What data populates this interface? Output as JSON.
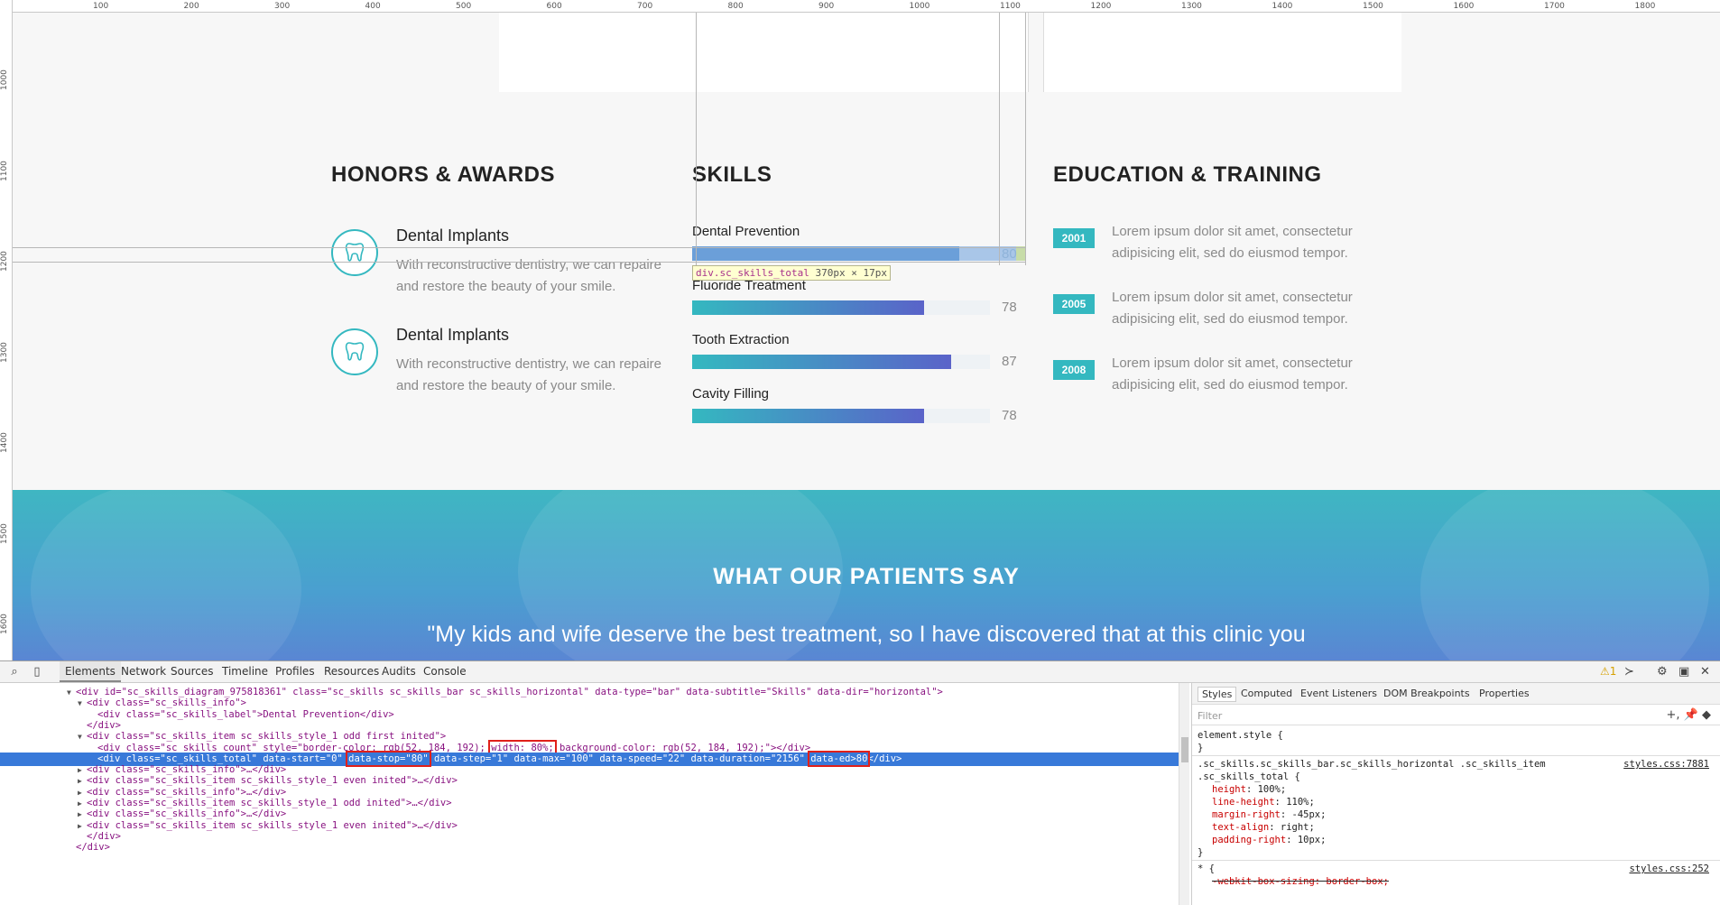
{
  "ruler": {
    "top": [
      "100",
      "200",
      "300",
      "400",
      "500",
      "600",
      "700",
      "800",
      "900",
      "1000",
      "1100",
      "1200",
      "1300",
      "1400",
      "1500",
      "1600",
      "1700",
      "1800"
    ],
    "left": [
      "1000",
      "1100",
      "1200",
      "1300",
      "1400",
      "1500",
      "1600"
    ]
  },
  "honors": {
    "title": "HONORS & AWARDS",
    "items": [
      {
        "title": "Dental Implants",
        "text": "With reconstructive dentistry, we can repaire and restore the beauty of your smile."
      },
      {
        "title": "Dental Implants",
        "text": "With reconstructive dentistry, we can repaire and restore the beauty of your smile."
      }
    ],
    "icon": "tooth-icon"
  },
  "skills": {
    "title": "SKILLS",
    "items": [
      {
        "label": "Dental Prevention",
        "value": "80",
        "percent": 80
      },
      {
        "label": "Fluoride Treatment",
        "value": "78",
        "percent": 78
      },
      {
        "label": "Tooth Extraction",
        "value": "87",
        "percent": 87
      },
      {
        "label": "Cavity Filling",
        "value": "78",
        "percent": 78
      }
    ],
    "tooltip": {
      "selector": "div.sc_skills_total",
      "size": "370px × 17px"
    }
  },
  "education": {
    "title": "EDUCATION & TRAINING",
    "items": [
      {
        "year": "2001",
        "text": "Lorem ipsum dolor sit amet, consectetur adipisicing elit, sed do eiusmod tempor."
      },
      {
        "year": "2005",
        "text": "Lorem ipsum dolor sit amet, consectetur adipisicing elit, sed do eiusmod tempor."
      },
      {
        "year": "2008",
        "text": "Lorem ipsum dolor sit amet, consectetur adipisicing elit, sed do eiusmod tempor."
      }
    ]
  },
  "testimonials": {
    "title": "WHAT OUR PATIENTS SAY",
    "quote": "\"My kids and wife deserve the best treatment, so I have discovered that at this clinic you"
  },
  "devtools": {
    "tabs": [
      "Elements",
      "Network",
      "Sources",
      "Timeline",
      "Profiles",
      "Resources",
      "Audits",
      "Console"
    ],
    "active_tab": "Elements",
    "warning_count": "1",
    "dom_lines": [
      {
        "indent": 0,
        "tri": "▼",
        "html": "<div id=\"sc_skills_diagram_975818361\" class=\"sc_skills sc_skills_bar sc_skills_horizontal\" data-type=\"bar\" data-subtitle=\"Skills\" data-dir=\"horizontal\">"
      },
      {
        "indent": 1,
        "tri": "▼",
        "html": "<div class=\"sc_skills_info\">"
      },
      {
        "indent": 2,
        "tri": "",
        "html": "<div class=\"sc_skills_label\">Dental Prevention</div>"
      },
      {
        "indent": 1,
        "tri": "",
        "html": "</div>"
      },
      {
        "indent": 1,
        "tri": "▼",
        "html": "<div class=\"sc_skills_item sc_skills_style_1 odd first inited\">"
      },
      {
        "indent": 2,
        "tri": "",
        "html": "<div class=\"sc_skills_count\" style=\"border-color: rgb(52, 184, 192); width: 80%; background-color: rgb(52, 184, 192);\"></div>"
      },
      {
        "indent": 2,
        "tri": "",
        "html": "<div class=\"sc_skills_total\" data-start=\"0\" data-stop=\"80\" data-step=\"1\" data-max=\"100\" data-speed=\"22\" data-duration=\"2156\" data-ed>80</div>",
        "selected": true
      },
      {
        "indent": 1,
        "tri": "▶",
        "html": "<div class=\"sc_skills_info\">…</div>"
      },
      {
        "indent": 1,
        "tri": "▶",
        "html": "<div class=\"sc_skills_item sc_skills_style_1 even inited\">…</div>"
      },
      {
        "indent": 1,
        "tri": "▶",
        "html": "<div class=\"sc_skills_info\">…</div>"
      },
      {
        "indent": 1,
        "tri": "▶",
        "html": "<div class=\"sc_skills_item sc_skills_style_1 odd inited\">…</div>"
      },
      {
        "indent": 1,
        "tri": "▶",
        "html": "<div class=\"sc_skills_info\">…</div>"
      },
      {
        "indent": 1,
        "tri": "▶",
        "html": "<div class=\"sc_skills_item sc_skills_style_1 even inited\">…</div>"
      },
      {
        "indent": 1,
        "tri": "",
        "html": "</div>"
      },
      {
        "indent": 0,
        "tri": "",
        "html": "</div>"
      }
    ],
    "style_tabs": [
      "Styles",
      "Computed",
      "Event Listeners",
      "DOM Breakpoints",
      "Properties"
    ],
    "style_active": "Styles",
    "filter_placeholder": "Filter",
    "element_style": "element.style {",
    "close_brace": "}",
    "rule_selector_1": ".sc_skills.sc_skills_bar.sc_skills_horizontal .sc_skills_item",
    "rule_selector_2": ".sc_skills_total {",
    "rule_link": "styles.css:7881",
    "rule_props": [
      {
        "prop": "height",
        "value": "100%;"
      },
      {
        "prop": "line-height",
        "value": "110%;"
      },
      {
        "prop": "margin-right",
        "value": "-45px;"
      },
      {
        "prop": "text-align",
        "value": "right;"
      },
      {
        "prop": "padding-right",
        "value": "10px;"
      }
    ],
    "rule2_selector": "* {",
    "rule2_link": "styles.css:252",
    "rule2_prop": "-webkit-box-sizing: border-box;"
  }
}
